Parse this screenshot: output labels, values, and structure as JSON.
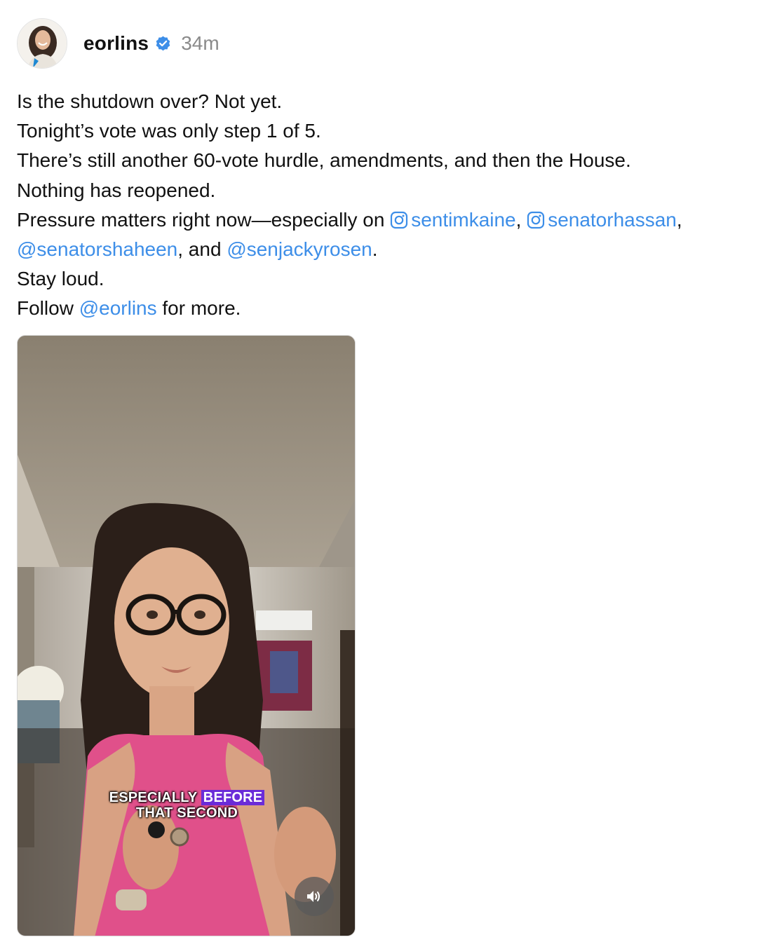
{
  "post": {
    "username": "eorlins",
    "timestamp": "34m",
    "verified_icon": "verified-badge-icon",
    "avatar_alt": "profile photo"
  },
  "caption": {
    "line1": "Is the shutdown over? Not yet.",
    "line2": "Tonight’s vote was only step 1 of 5.",
    "line3": "There’s still another 60-vote hurdle, amendments, and then the House.",
    "line4": "Nothing has reopened.",
    "line5_prefix": "Pressure matters right now—especially on ",
    "mention_kaine": "sentimkaine",
    "sep1": ", ",
    "mention_hassan": "senatorhassan",
    "sep2": ",",
    "mention_shaheen": "@senatorshaheen",
    "sep3": ", and ",
    "mention_rosen": "@senjackyrosen",
    "sep4": ".",
    "line7": "Stay loud.",
    "follow_prefix": "Follow ",
    "mention_eorlins": "@eorlins",
    "follow_suffix": " for more."
  },
  "video": {
    "subtitle_part1": "ESPECIALLY ",
    "subtitle_highlight": "BEFORE",
    "subtitle_line2": "THAT SECOND",
    "mute_icon": "speaker-muted-icon"
  },
  "colors": {
    "link": "#3d8ee8",
    "verified": "#3d8ee8",
    "timestamp": "#8a8a8a",
    "subtitle_highlight": "#6a2bd8"
  }
}
